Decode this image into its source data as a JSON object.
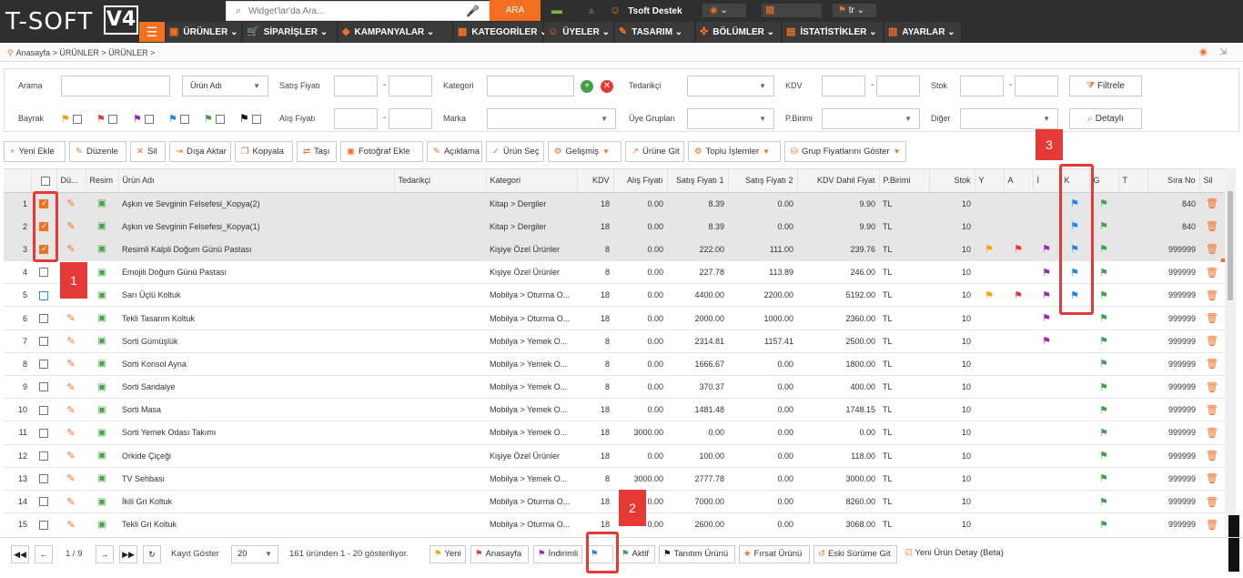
{
  "header": {
    "logo_text": "T-SOFT",
    "logo_version": "V4",
    "search_placeholder": "Widget'lar'da Ara...",
    "search_button": "ARA",
    "support_label": "Tsoft Destek",
    "lang": "tr",
    "menu": [
      {
        "label": "ÜRÜNLER",
        "icon": "▣"
      },
      {
        "label": "SİPARİŞLER",
        "icon": "🛒"
      },
      {
        "label": "KAMPANYALAR",
        "icon": "◆"
      },
      {
        "label": "KATEGORİLER",
        "icon": "▦"
      },
      {
        "label": "ÜYELER",
        "icon": "☺"
      },
      {
        "label": "TASARIM",
        "icon": "✎"
      },
      {
        "label": "BÖLÜMLER",
        "icon": "✜"
      },
      {
        "label": "İSTATİSTİKLER",
        "icon": "▤"
      },
      {
        "label": "AYARLAR",
        "icon": "▥"
      }
    ]
  },
  "breadcrumb": "Anasayfa > ÜRÜNLER > ÜRÜNLER >",
  "filter": {
    "arama": "Arama",
    "urun_adi": "Ürün Adı",
    "satis_fiyati": "Satış Fiyatı",
    "kategori": "Kategori",
    "tedarikci": "Tedarikçi",
    "kdv": "KDV",
    "stok": "Stok",
    "filtrele": "Filtrele",
    "bayrak": "Bayrak",
    "alis_fiyati": "Alış Fiyatı",
    "marka": "Marka",
    "uye_gruplari": "Üye Grupları",
    "pbirimi": "P.Birimi",
    "diger": "Diğer",
    "detayli": "Detaylı",
    "dash": "-"
  },
  "toolbar": [
    {
      "label": "Yeni Ekle",
      "icon": "+"
    },
    {
      "label": "Düzenle",
      "icon": "✎"
    },
    {
      "label": "Sil",
      "icon": "✕"
    },
    {
      "label": "Dışa Aktar",
      "icon": "⇥"
    },
    {
      "label": "Kopyala",
      "icon": "❐"
    },
    {
      "label": "Taşı",
      "icon": "⇄"
    },
    {
      "label": "Fotoğraf Ekle",
      "icon": "▣"
    },
    {
      "label": "Açıklama",
      "icon": "✎"
    },
    {
      "label": "Ürün Seç",
      "icon": "✓"
    },
    {
      "label": "Gelişmiş",
      "icon": "⚙"
    },
    {
      "label": "Ürüne Git",
      "icon": "↗"
    },
    {
      "label": "Toplu İşlemler",
      "icon": "⚙"
    },
    {
      "label": "Grup Fiyatlarını Göster",
      "icon": "⛁"
    }
  ],
  "columns": [
    "",
    "",
    "Dü...",
    "Resim",
    "Ürün Adı",
    "Tedarikçi",
    "Kategori",
    "KDV",
    "Alış Fiyatı",
    "Satış Fiyatı 1",
    "Satış Fiyatı 2",
    "KDV Dahil Fiyat",
    "P.Birimi",
    "Stok",
    "Y",
    "A",
    "İ",
    "K",
    "G",
    "T",
    "Sıra No",
    "Sil"
  ],
  "rows": [
    {
      "n": "1",
      "name": "Aşkın ve Sevginin Felsefesi_Kopya(2)",
      "cat": "Kitap > Dergiler",
      "kdv": "18",
      "alis": "0.00",
      "s1": "8.39",
      "s2": "0.00",
      "kdvf": "9.90",
      "pb": "TL",
      "stok": "10",
      "y": false,
      "a": false,
      "i": false,
      "k": true,
      "g": true,
      "sira": "840",
      "checked": true,
      "sel": true
    },
    {
      "n": "2",
      "name": "Aşkın ve Sevginin Felsefesi_Kopya(1)",
      "cat": "Kitap > Dergiler",
      "kdv": "18",
      "alis": "0.00",
      "s1": "8.39",
      "s2": "0.00",
      "kdvf": "9.90",
      "pb": "TL",
      "stok": "10",
      "y": false,
      "a": false,
      "i": false,
      "k": true,
      "g": true,
      "sira": "840",
      "checked": true,
      "sel": true
    },
    {
      "n": "3",
      "name": "Resimli Kalpli Doğum Günü Pastası",
      "cat": "Kişiye Özel Ürünler",
      "kdv": "8",
      "alis": "0.00",
      "s1": "222.00",
      "s2": "111.00",
      "kdvf": "239.76",
      "pb": "TL",
      "stok": "10",
      "y": true,
      "a": true,
      "i": true,
      "k": true,
      "g": true,
      "sira": "999999",
      "checked": true,
      "sel": true
    },
    {
      "n": "4",
      "name": "Emojili Doğum Günü Pastası",
      "cat": "Kişiye Özel Ürünler",
      "kdv": "8",
      "alis": "0.00",
      "s1": "227.78",
      "s2": "113.89",
      "kdvf": "246.00",
      "pb": "TL",
      "stok": "10",
      "y": false,
      "a": false,
      "i": true,
      "k": true,
      "g": true,
      "sira": "999999",
      "checked": false,
      "sel": false
    },
    {
      "n": "5",
      "name": "Sarı Üçlü Koltuk",
      "cat": "Mobilya > Oturma O...",
      "kdv": "18",
      "alis": "0.00",
      "s1": "4400.00",
      "s2": "2200.00",
      "kdvf": "5192.00",
      "pb": "TL",
      "stok": "10",
      "y": true,
      "a": true,
      "i": true,
      "k": true,
      "g": true,
      "sira": "999999",
      "checked": false,
      "sel": false,
      "blue": true
    },
    {
      "n": "6",
      "name": "Tekli Tasarım Koltuk",
      "cat": "Mobilya > Oturma O...",
      "kdv": "18",
      "alis": "0.00",
      "s1": "2000.00",
      "s2": "1000.00",
      "kdvf": "2360.00",
      "pb": "TL",
      "stok": "10",
      "y": false,
      "a": false,
      "i": true,
      "k": false,
      "g": true,
      "sira": "999999",
      "checked": false,
      "sel": false
    },
    {
      "n": "7",
      "name": "Sorti Gümüşlük",
      "cat": "Mobilya > Yemek O...",
      "kdv": "8",
      "alis": "0.00",
      "s1": "2314.81",
      "s2": "1157.41",
      "kdvf": "2500.00",
      "pb": "TL",
      "stok": "10",
      "y": false,
      "a": false,
      "i": true,
      "k": false,
      "g": true,
      "sira": "999999",
      "checked": false,
      "sel": false
    },
    {
      "n": "8",
      "name": "Sorti Konsol Ayna",
      "cat": "Mobilya > Yemek O...",
      "kdv": "8",
      "alis": "0.00",
      "s1": "1666.67",
      "s2": "0.00",
      "kdvf": "1800.00",
      "pb": "TL",
      "stok": "10",
      "y": false,
      "a": false,
      "i": false,
      "k": false,
      "g": true,
      "sira": "999999",
      "checked": false,
      "sel": false
    },
    {
      "n": "9",
      "name": "Sorti Sandalye",
      "cat": "Mobilya > Yemek O...",
      "kdv": "8",
      "alis": "0.00",
      "s1": "370.37",
      "s2": "0.00",
      "kdvf": "400.00",
      "pb": "TL",
      "stok": "10",
      "y": false,
      "a": false,
      "i": false,
      "k": false,
      "g": true,
      "sira": "999999",
      "checked": false,
      "sel": false
    },
    {
      "n": "10",
      "name": "Sorti Masa",
      "cat": "Mobilya > Yemek O...",
      "kdv": "18",
      "alis": "0.00",
      "s1": "1481.48",
      "s2": "0.00",
      "kdvf": "1748.15",
      "pb": "TL",
      "stok": "10",
      "y": false,
      "a": false,
      "i": false,
      "k": false,
      "g": true,
      "sira": "999999",
      "checked": false,
      "sel": false
    },
    {
      "n": "11",
      "name": "Sorti Yemek Odası Takımı",
      "cat": "Mobilya > Yemek O...",
      "kdv": "18",
      "alis": "3000.00",
      "s1": "0.00",
      "s2": "0.00",
      "kdvf": "0.00",
      "pb": "TL",
      "stok": "10",
      "y": false,
      "a": false,
      "i": false,
      "k": false,
      "g": true,
      "sira": "999999",
      "checked": false,
      "sel": false
    },
    {
      "n": "12",
      "name": "Orkide Çiçeği",
      "cat": "Kişiye Özel Ürünler",
      "kdv": "18",
      "alis": "0.00",
      "s1": "100.00",
      "s2": "0.00",
      "kdvf": "118.00",
      "pb": "TL",
      "stok": "10",
      "y": false,
      "a": false,
      "i": false,
      "k": false,
      "g": true,
      "sira": "999999",
      "checked": false,
      "sel": false
    },
    {
      "n": "13",
      "name": "TV Sehbası",
      "cat": "Mobilya > Yemek O...",
      "kdv": "8",
      "alis": "3000.00",
      "s1": "2777.78",
      "s2": "0.00",
      "kdvf": "3000.00",
      "pb": "TL",
      "stok": "10",
      "y": false,
      "a": false,
      "i": false,
      "k": false,
      "g": true,
      "sira": "999999",
      "checked": false,
      "sel": false
    },
    {
      "n": "14",
      "name": "İkili Gri Koltuk",
      "cat": "Mobilya > Oturma O...",
      "kdv": "18",
      "alis": "0.00",
      "s1": "7000.00",
      "s2": "0.00",
      "kdvf": "8260.00",
      "pb": "TL",
      "stok": "10",
      "y": false,
      "a": false,
      "i": false,
      "k": false,
      "g": true,
      "sira": "999999",
      "checked": false,
      "sel": false
    },
    {
      "n": "15",
      "name": "Tekli Gri Koltuk",
      "cat": "Mobilya > Oturma O...",
      "kdv": "18",
      "alis": "0.00",
      "s1": "2600.00",
      "s2": "0.00",
      "kdvf": "3068.00",
      "pb": "TL",
      "stok": "10",
      "y": false,
      "a": false,
      "i": false,
      "k": false,
      "g": true,
      "sira": "999999",
      "checked": false,
      "sel": false
    }
  ],
  "pager": {
    "page": "1 / 9",
    "kayit_goster": "Kayıt Göster",
    "page_size": "20",
    "summary": "161 üründen 1 - 20 gösteriliyor.",
    "legend": [
      {
        "label": "Yeni",
        "color": "#ffa000"
      },
      {
        "label": "Anasayfa",
        "color": "#e53935"
      },
      {
        "label": "İndirimli",
        "color": "#9c27b0"
      },
      {
        "label": "",
        "color": "#1e88e5"
      },
      {
        "label": "Aktif",
        "color": "#43a047"
      },
      {
        "label": "Tanıtım Ürünü",
        "color": "#111111"
      },
      {
        "label": "Fırsat Ürünü",
        "color": "#f37021"
      },
      {
        "label": "Eski Sürüme Git",
        "color": "#f37021"
      },
      {
        "label": "Yeni Ürün Detay (Beta)",
        "color": "#f37021"
      }
    ]
  },
  "annotations": [
    "1",
    "2",
    "3"
  ],
  "colors": {
    "accent": "#f37021",
    "highlight": "#e53935"
  }
}
